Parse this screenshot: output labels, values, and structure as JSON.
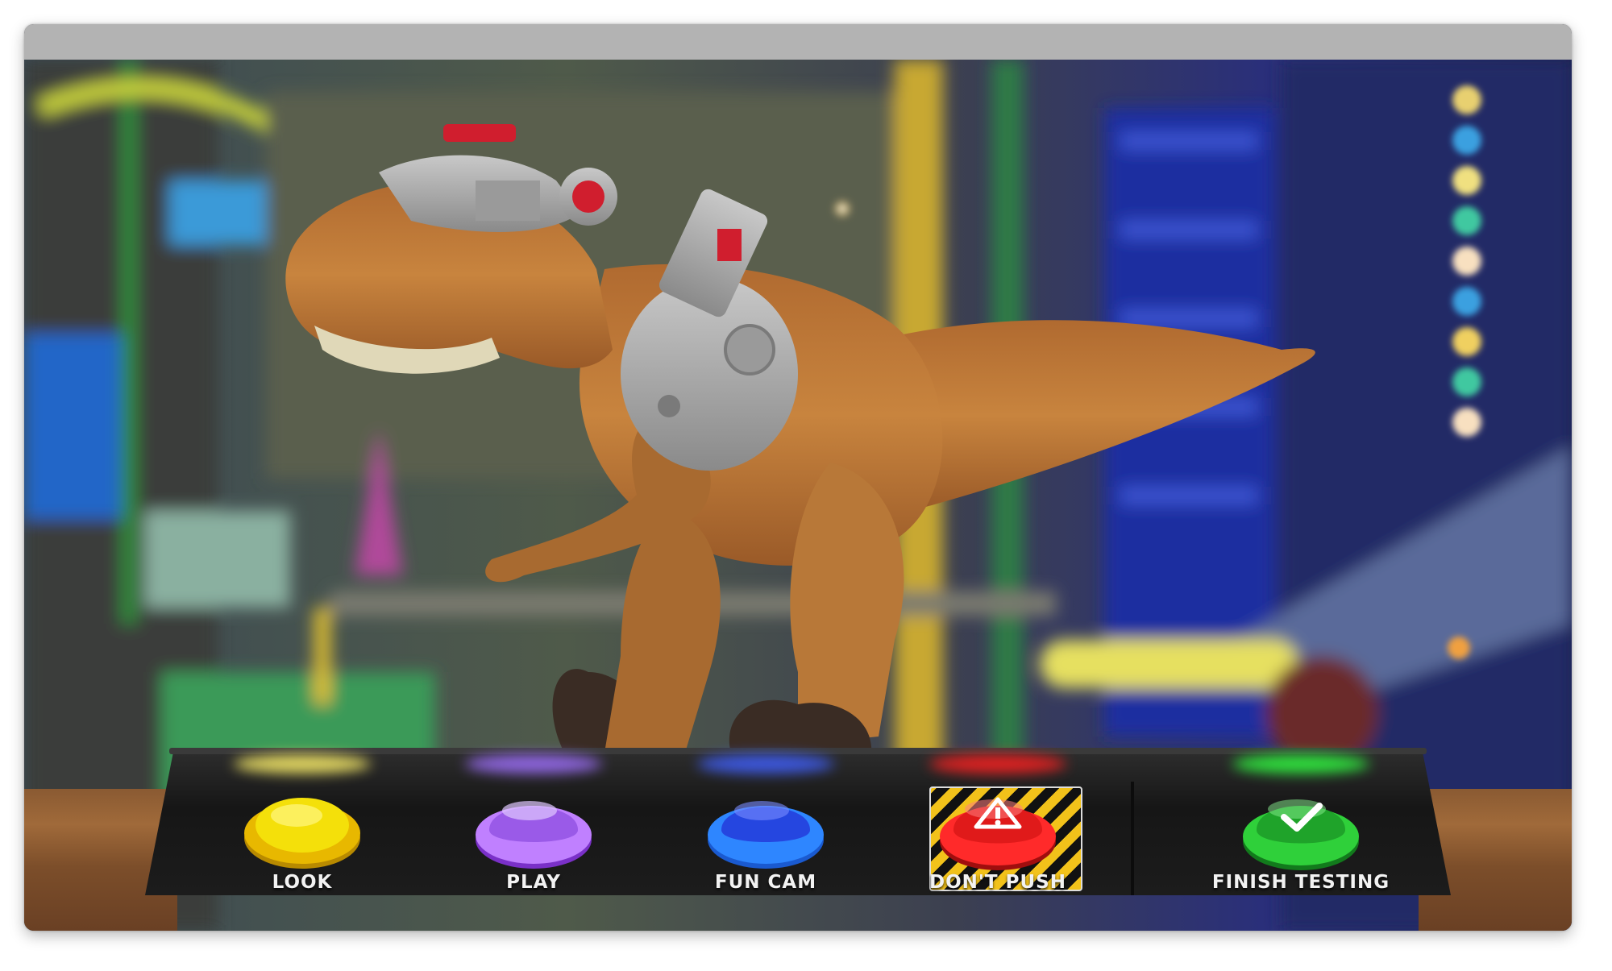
{
  "controls": [
    {
      "id": "look",
      "label": "LOOK",
      "color": "#f4e00a",
      "ring": "#e8b800",
      "glow": "#fff26a",
      "icon": "none"
    },
    {
      "id": "play",
      "label": "PLAY",
      "color": "#9a5ae8",
      "ring": "#c080ff",
      "glow": "#a070ff",
      "icon": "none"
    },
    {
      "id": "fun-cam",
      "label": "FUN CAM",
      "color": "#2546e0",
      "ring": "#2e86ff",
      "glow": "#4060ff",
      "icon": "none"
    },
    {
      "id": "dont-push",
      "label": "DON'T PUSH",
      "color": "#e01a1a",
      "ring": "#ff2a2a",
      "glow": "#ff2020",
      "icon": "warning-icon"
    },
    {
      "id": "finish-testing",
      "label": "FINISH TESTING",
      "color": "#1fa32a",
      "ring": "#2fd03a",
      "glow": "#30ff40",
      "icon": "checkmark-icon"
    }
  ],
  "scene": {
    "subject": "trex-toy-icon",
    "colors": {
      "dino": "#c07a3a",
      "dino_dark": "#8a4e22",
      "armor": "#a8a8a8",
      "accent_red": "#d01e2e"
    }
  }
}
